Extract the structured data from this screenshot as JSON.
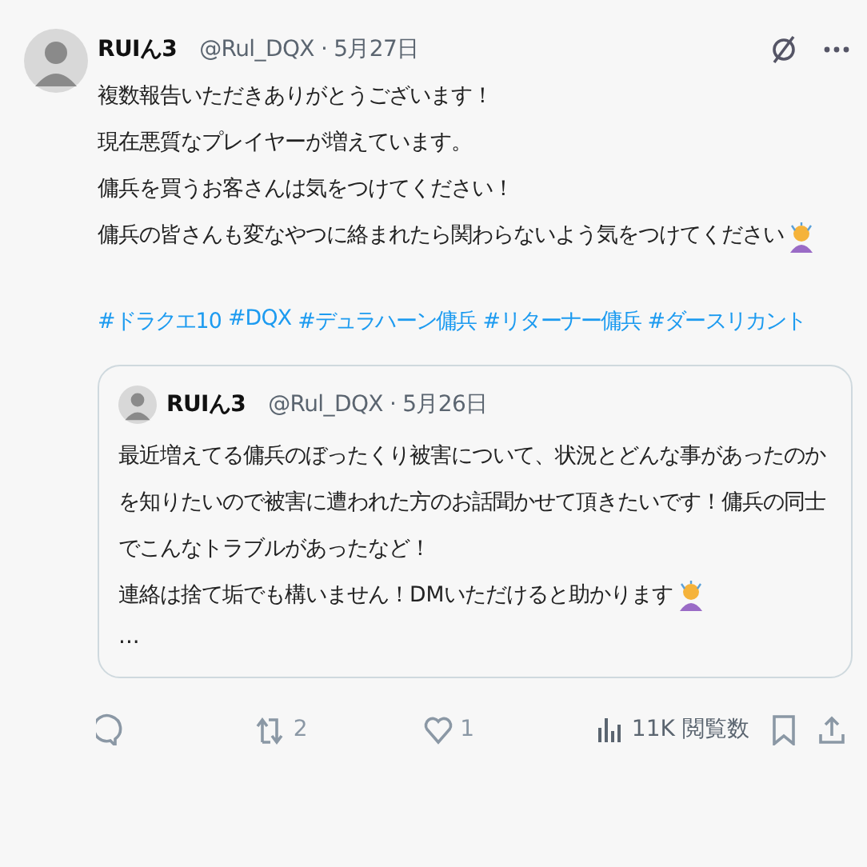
{
  "post": {
    "display_name": "RUIん3",
    "handle": "@Rul_DQX",
    "separator": "·",
    "date": "5月27日",
    "lines": [
      "複数報告いただきありがとうございます！",
      "現在悪質なプレイヤーが増えています。",
      "傭兵を買うお客さんは気をつけてください！",
      "傭兵の皆さんも変なやつに絡まれたら関わらないよう気をつけてください"
    ],
    "hashtags": [
      "#ドラクエ10",
      "#DQX",
      "#デュラハーン傭兵",
      "#リターナー傭兵",
      "#ダースリカント"
    ]
  },
  "quoted": {
    "display_name": "RUIん3",
    "handle": "@Rul_DQX",
    "separator": "·",
    "date": "5月26日",
    "lines": [
      "最近増えてる傭兵のぼったくり被害について、状況とどんな事があったのかを知りたいので被害に遭われた方のお話聞かせて頂きたいです！傭兵の同士でこんなトラブルがあったなど！",
      "連絡は捨て垢でも構いません！DMいただけると助かります"
    ],
    "more": "..."
  },
  "actions": [
    {
      "kind": "reply"
    },
    {
      "kind": "repost",
      "count": "2"
    },
    {
      "kind": "like",
      "count": "1"
    },
    {
      "kind": "views",
      "count": "11K 閲覧数"
    },
    {
      "kind": "bookmark"
    },
    {
      "kind": "share"
    }
  ]
}
